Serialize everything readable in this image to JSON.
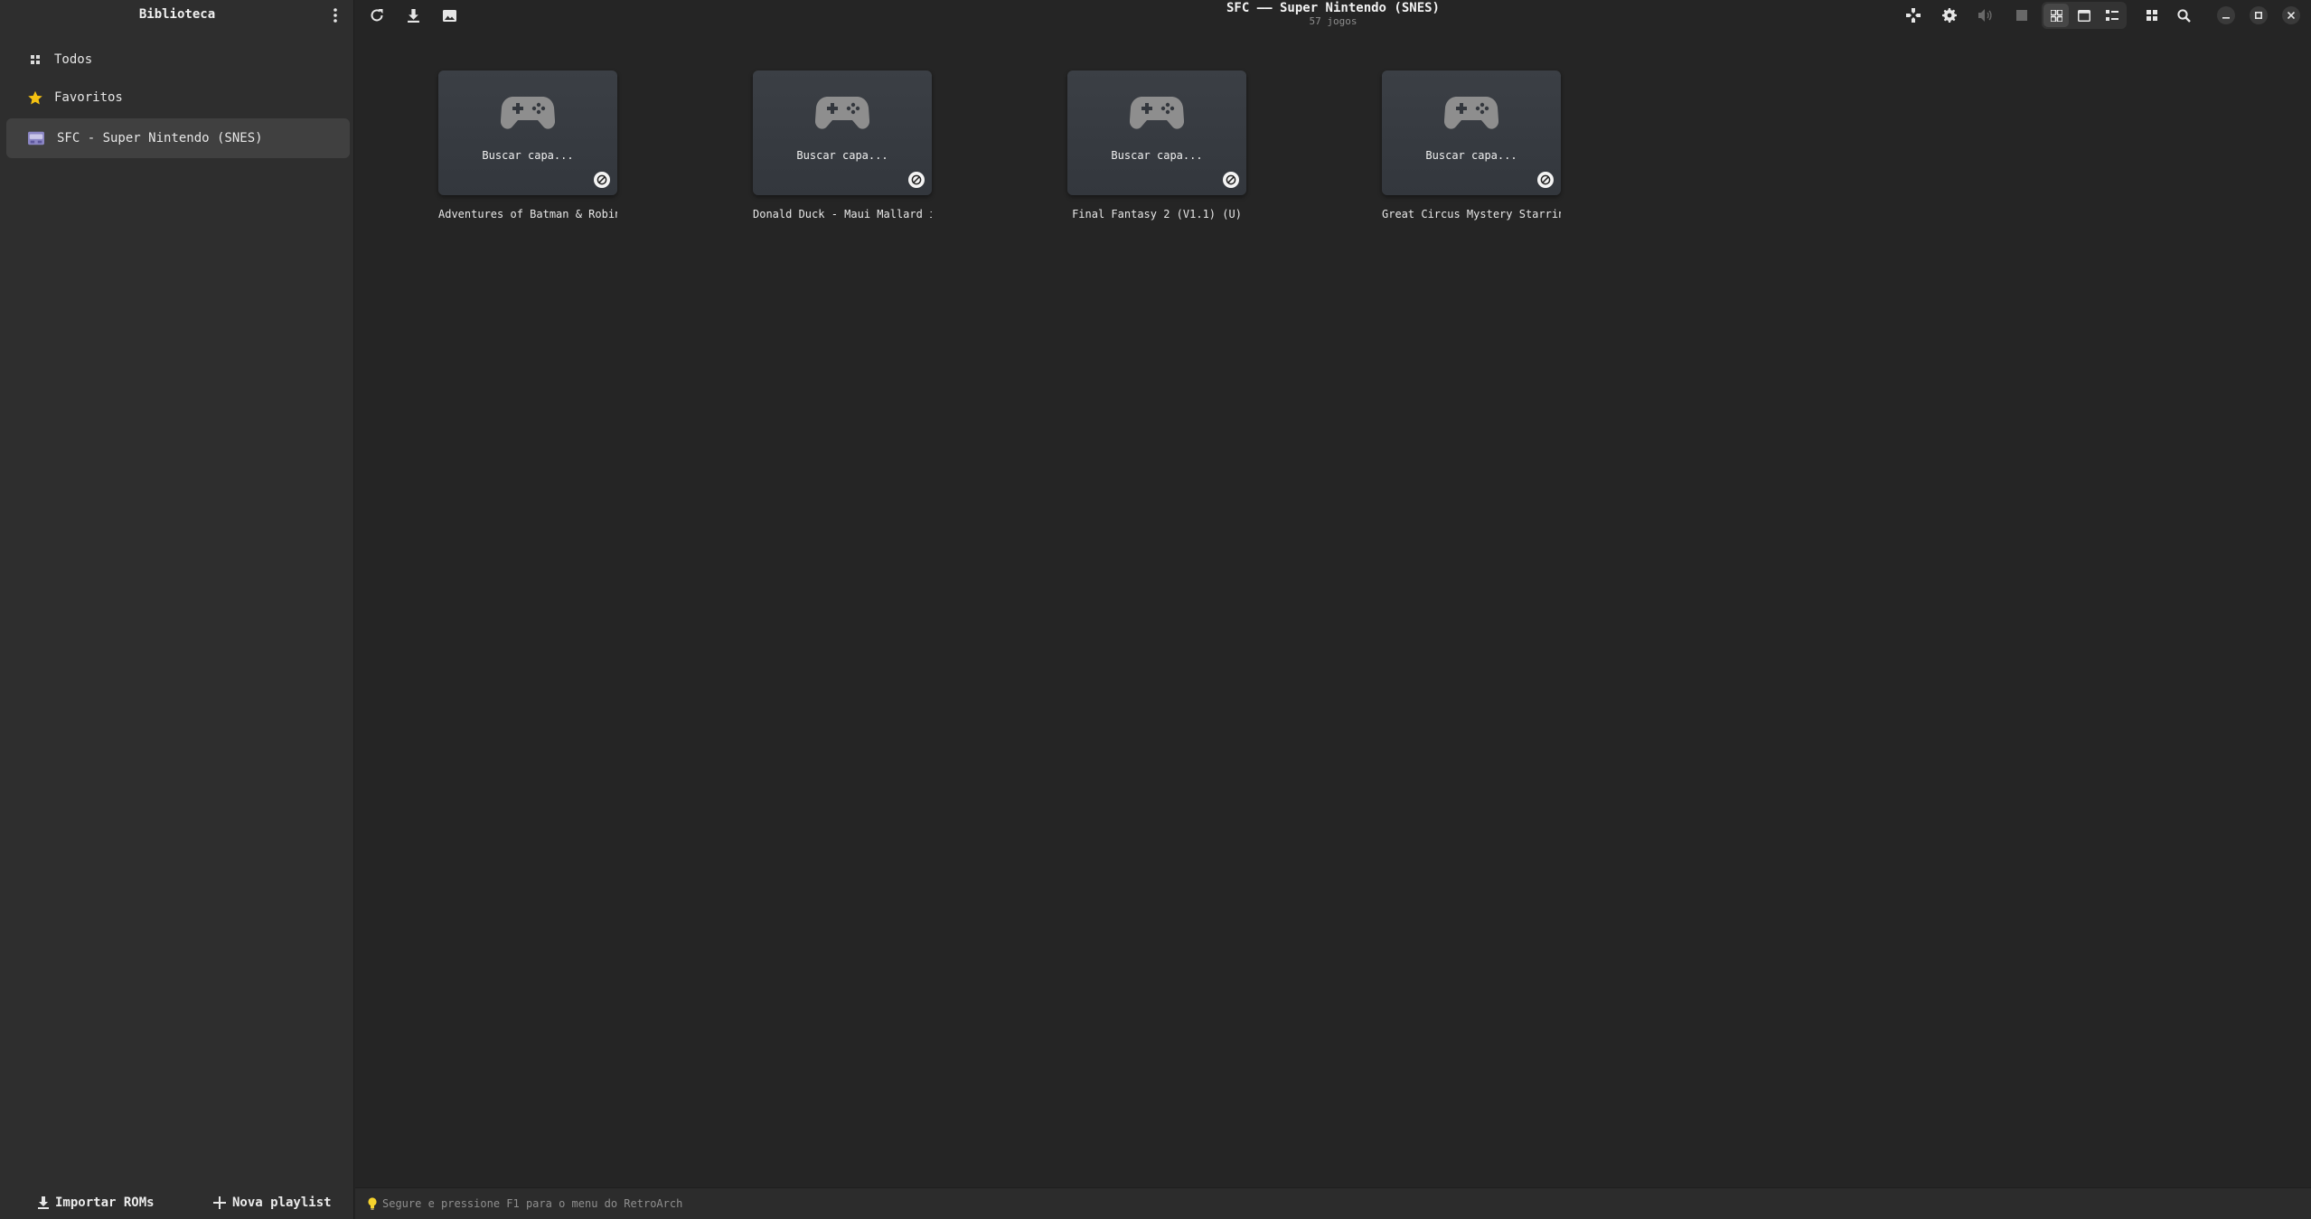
{
  "sidebar": {
    "title": "Biblioteca",
    "items": [
      {
        "label": "Todos",
        "icon": "grid-icon"
      },
      {
        "label": "Favoritos",
        "icon": "star-icon",
        "icon_color": "#f5c211"
      },
      {
        "label": "SFC - Super Nintendo (SNES)",
        "icon": "snes-console-icon",
        "selected": true
      }
    ],
    "footer": {
      "import_label": "Importar ROMs",
      "new_playlist_label": "Nova playlist"
    }
  },
  "header": {
    "title": "SFC –– Super Nintendo (SNES)",
    "subtitle": "57 jogos",
    "left_icons": [
      "refresh-icon",
      "download-icon",
      "image-icon"
    ],
    "right_icons": [
      "gamepad-icon",
      "gear-icon",
      "volume-icon",
      "stop-icon",
      "grid-view-icon",
      "detail-view-icon",
      "list-view-icon",
      "apps-icon",
      "search-icon",
      "minimize-icon",
      "maximize-icon",
      "close-icon"
    ],
    "active_view": "grid-view"
  },
  "games": [
    {
      "title": "Adventures of Batman & Robin, ...",
      "placeholder": "Buscar capa..."
    },
    {
      "title": "Donald Duck - Maui Mallard in ...",
      "placeholder": "Buscar capa..."
    },
    {
      "title": "Final Fantasy 2 (V1.1) (U)",
      "placeholder": "Buscar capa..."
    },
    {
      "title": "Great Circus Mystery Starring ...",
      "placeholder": "Buscar capa..."
    }
  ],
  "status": {
    "tip": "Segure  e pressione F1 para o menu do RetroArch",
    "icon": "lightbulb-icon"
  },
  "colors": {
    "background": "#252525",
    "sidebar": "#2e2e2e",
    "selected": "#404040",
    "star": "#f5c211"
  }
}
